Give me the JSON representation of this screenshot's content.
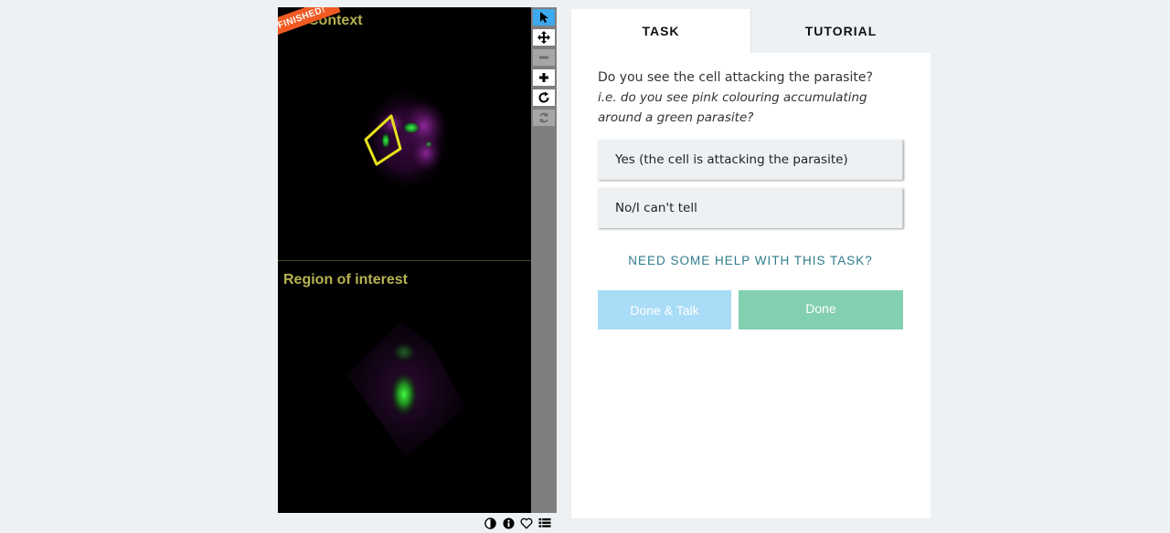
{
  "viewer": {
    "badge": "FINISHED!",
    "frame_top_label": "Context",
    "frame_bottom_label": "Region of interest",
    "tools": [
      {
        "name": "pointer-icon",
        "state": "active"
      },
      {
        "name": "move-icon",
        "state": "enabled"
      },
      {
        "name": "zoom-out-icon",
        "state": "disabled"
      },
      {
        "name": "zoom-in-icon",
        "state": "enabled"
      },
      {
        "name": "rotate-icon",
        "state": "enabled"
      },
      {
        "name": "reset-icon",
        "state": "disabled"
      }
    ],
    "meta_icons": [
      "invert-icon",
      "info-icon",
      "heart-icon",
      "collections-icon"
    ]
  },
  "tabs": {
    "task": "TASK",
    "tutorial": "TUTORIAL"
  },
  "task": {
    "question": "Do you see the cell attacking the parasite?",
    "question_detail_1": "i.e. do you see pink colouring accumulating",
    "question_detail_2": "around a green parasite?",
    "answers": [
      {
        "label": "Yes (the cell is attacking the parasite)"
      },
      {
        "label": "No/I can't tell"
      }
    ],
    "help": "NEED SOME HELP WITH THIS TASK?",
    "done_talk": "Done & Talk",
    "done": "Done"
  },
  "colors": {
    "accent_blue": "#3da9ee",
    "badge_orange": "#f15a22",
    "done_green": "#82d0b0",
    "talk_blue": "#a9dcf6",
    "help_teal": "#2e7d8c",
    "label_olive": "#b7b252",
    "roi_outline": "#e6e21c"
  }
}
